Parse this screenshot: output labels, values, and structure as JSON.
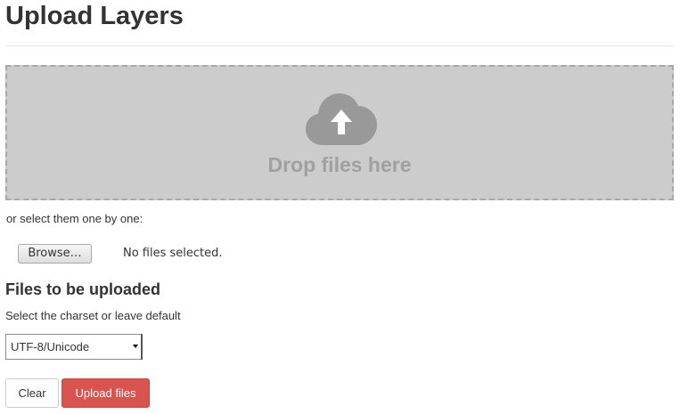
{
  "page": {
    "title": "Upload Layers"
  },
  "drop_zone": {
    "text": "Drop files here",
    "icon": "cloud-upload-icon",
    "background_color": "#cccccc",
    "icon_color": "#999999"
  },
  "file_select": {
    "hint": "or select them one by one:",
    "browse_label": "Browse…",
    "status": "No files selected."
  },
  "upload_section": {
    "title": "Files to be uploaded",
    "charset_label": "Select the charset or leave default",
    "charset_selected": "UTF-8/Unicode"
  },
  "actions": {
    "clear_label": "Clear",
    "upload_label": "Upload files",
    "upload_color": "#d9534f"
  }
}
